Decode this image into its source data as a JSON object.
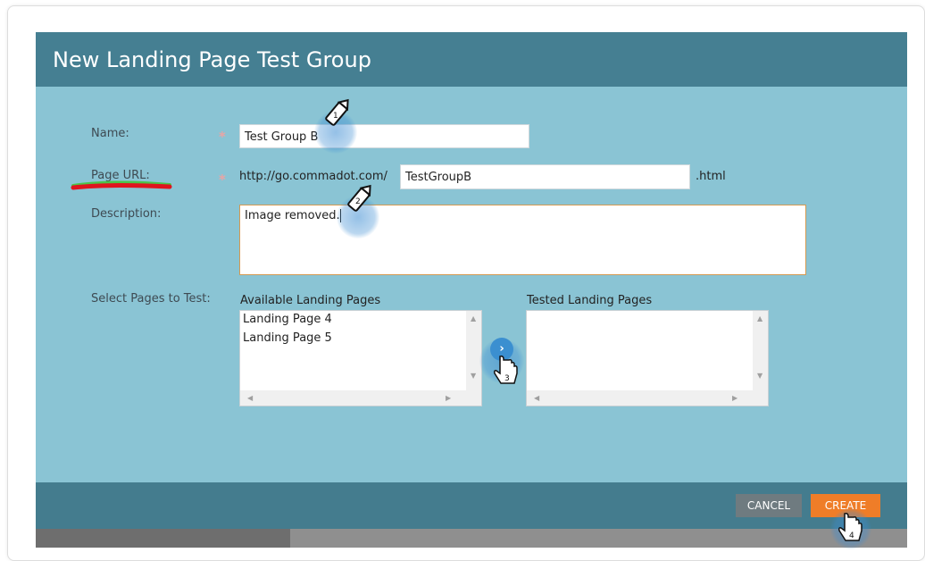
{
  "dialog": {
    "title": "New Landing Page Test Group",
    "name_label": "Name:",
    "name_value": "Test Group B",
    "page_url_label": "Page URL:",
    "url_prefix": "http://go.commadot.com/",
    "url_value": "TestGroupB",
    "url_suffix": ".html",
    "description_label": "Description:",
    "description_value": "Image removed.",
    "select_pages_label": "Select Pages to Test:",
    "available_label": "Available Landing Pages",
    "available_items": [
      "Landing Page 4",
      "Landing Page 5"
    ],
    "tested_label": "Tested Landing Pages",
    "move_symbol": "›",
    "required_symbol": "*"
  },
  "footer": {
    "cancel_label": "CANCEL",
    "create_label": "CREATE"
  },
  "annotations": {
    "step1": "1",
    "step2": "2",
    "step3": "3",
    "step4": "4"
  },
  "colors": {
    "title_bar": "#457f92",
    "dialog_body": "#8ac4d4",
    "create_button": "#ef7d28",
    "cancel_button": "#6f7b80",
    "highlight_red": "#e0141e",
    "highlight_green": "#4cc34a"
  }
}
